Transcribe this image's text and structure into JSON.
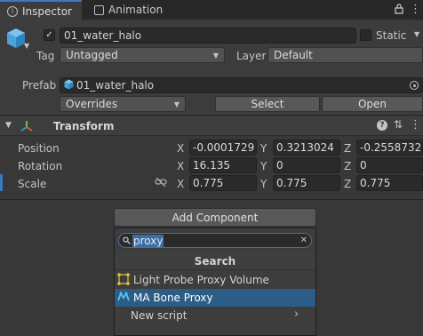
{
  "tabs": [
    {
      "label": "Inspector",
      "icon": "info-icon"
    },
    {
      "label": "Animation",
      "icon": "animation-icon"
    }
  ],
  "object": {
    "active": true,
    "name": "01_water_halo",
    "static_label": "Static",
    "tag_label": "Tag",
    "tag_value": "Untagged",
    "layer_label": "Layer",
    "layer_value": "Default",
    "prefab_label": "Prefab",
    "prefab_value": "01_water_halo",
    "overrides_label": "Overrides",
    "select_label": "Select",
    "open_label": "Open"
  },
  "transform": {
    "title": "Transform",
    "rows": [
      {
        "label": "Position",
        "x": "-0.0001729",
        "y": "0.3213024",
        "z": "-0.2558732"
      },
      {
        "label": "Rotation",
        "x": "16.135",
        "y": "0",
        "z": "0"
      },
      {
        "label": "Scale",
        "x": "0.775",
        "y": "0.775",
        "z": "0.775"
      }
    ],
    "axes": {
      "x": "X",
      "y": "Y",
      "z": "Z"
    }
  },
  "add_component": {
    "button_label": "Add Component",
    "search_value": "proxy",
    "popup_title": "Search",
    "items": [
      {
        "label": "Light Probe Proxy Volume",
        "icon": "light-probe-proxy-icon",
        "selected": false
      },
      {
        "label": "MA Bone Proxy",
        "icon": "ma-bone-proxy-icon",
        "selected": true
      },
      {
        "label": "New script",
        "icon": "",
        "selected": false
      }
    ]
  },
  "colors": {
    "accent": "#3a79bb",
    "selection": "#2c5d87",
    "background": "#383838"
  }
}
